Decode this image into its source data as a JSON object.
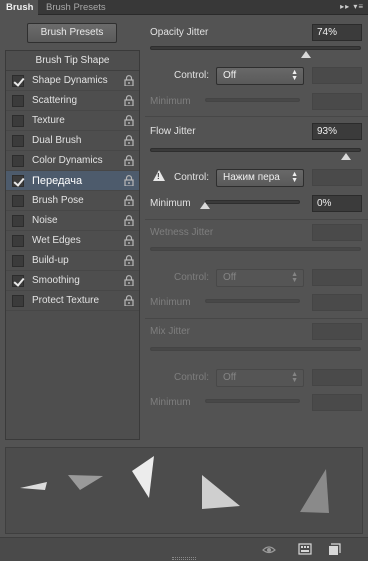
{
  "tabs": {
    "brush": "Brush",
    "presets": "Brush Presets",
    "menu": "▸▸ ▾≡"
  },
  "left": {
    "presets_button": "Brush Presets",
    "list_header": "Brush Tip Shape",
    "items": [
      {
        "label": "Shape Dynamics",
        "checked": true,
        "selected": false
      },
      {
        "label": "Scattering",
        "checked": false,
        "selected": false
      },
      {
        "label": "Texture",
        "checked": false,
        "selected": false
      },
      {
        "label": "Dual Brush",
        "checked": false,
        "selected": false
      },
      {
        "label": "Color Dynamics",
        "checked": false,
        "selected": false
      },
      {
        "label": "Передача",
        "checked": true,
        "selected": true
      },
      {
        "label": "Brush Pose",
        "checked": false,
        "selected": false
      },
      {
        "label": "Noise",
        "checked": false,
        "selected": false
      },
      {
        "label": "Wet Edges",
        "checked": false,
        "selected": false
      },
      {
        "label": "Build-up",
        "checked": false,
        "selected": false
      },
      {
        "label": "Smoothing",
        "checked": true,
        "selected": false
      },
      {
        "label": "Protect Texture",
        "checked": false,
        "selected": false
      }
    ]
  },
  "right": {
    "opacity": {
      "label": "Opacity Jitter",
      "value": "74%",
      "level": 0.74,
      "control_label": "Control:",
      "control_value": "Off",
      "minimum_label": "Minimum"
    },
    "flow": {
      "label": "Flow Jitter",
      "value": "93%",
      "level": 0.93,
      "control_label": "Control:",
      "control_value": "Нажим пера",
      "minimum_label": "Minimum",
      "minimum_value": "0%",
      "minimum_level": 0.0
    },
    "wetness": {
      "label": "Wetness Jitter",
      "control_label": "Control:",
      "control_value": "Off",
      "minimum_label": "Minimum"
    },
    "mix": {
      "label": "Mix Jitter",
      "control_label": "Control:",
      "control_value": "Off",
      "minimum_label": "Minimum"
    }
  },
  "icons": {
    "lock": "lock-icon",
    "warning": "warning-icon",
    "eye": "toggle-preview-icon",
    "grid": "brush-panel-icon",
    "new": "new-preset-icon"
  }
}
